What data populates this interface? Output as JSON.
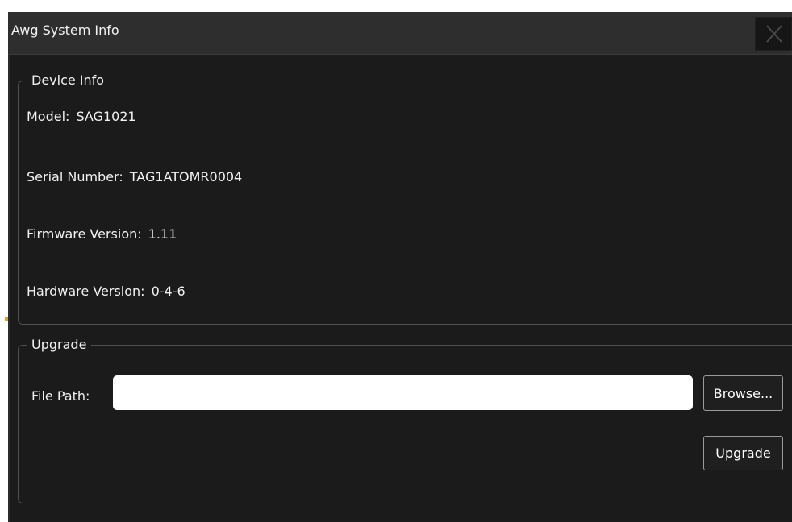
{
  "window": {
    "title": "Awg System Info",
    "close_glyph": "✕"
  },
  "device_info": {
    "legend": "Device Info",
    "rows": [
      {
        "label": "Model:",
        "value": "SAG1021"
      },
      {
        "label": "Serial Number:",
        "value": "TAG1ATOMR0004"
      },
      {
        "label": "Firmware Version:",
        "value": "1.11"
      },
      {
        "label": "Hardware Version:",
        "value": "0-4-6"
      }
    ]
  },
  "upgrade": {
    "legend": "Upgrade",
    "file_path_label": "File Path:",
    "file_path_value": "",
    "browse_label": "Browse...",
    "upgrade_label": "Upgrade"
  },
  "colors": {
    "background": "#1b1b1b",
    "titlebar": "#2e2e2e",
    "text": "#f2f2f2",
    "group_border": "#505050"
  }
}
